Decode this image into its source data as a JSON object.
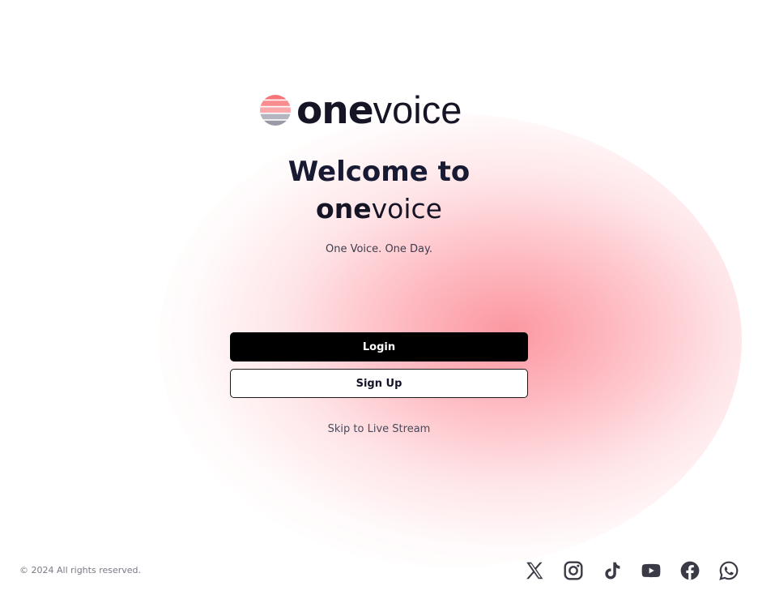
{
  "brand": {
    "name_bold": "one",
    "name_light": "voice",
    "mark_colors": [
      "#f7747a",
      "#f98c8f",
      "#fba8aa",
      "#b5b5bf",
      "#9a9aa6"
    ]
  },
  "hero": {
    "welcome": "Welcome to",
    "name_bold": "one",
    "name_light": "voice",
    "tagline": "One Voice. One Day."
  },
  "actions": {
    "login_label": "Login",
    "signup_label": "Sign Up",
    "skip_label": "Skip to Live Stream"
  },
  "footer": {
    "copyright": "© 2024 All rights reserved.",
    "socials": [
      "x-icon",
      "instagram-icon",
      "tiktok-icon",
      "youtube-icon",
      "facebook-icon",
      "whatsapp-icon"
    ]
  },
  "colors": {
    "glow": "#fc8c96",
    "primary": "#000000",
    "text_dark": "#181a33",
    "muted": "#7a7a85",
    "icon": "#3a3a46"
  }
}
